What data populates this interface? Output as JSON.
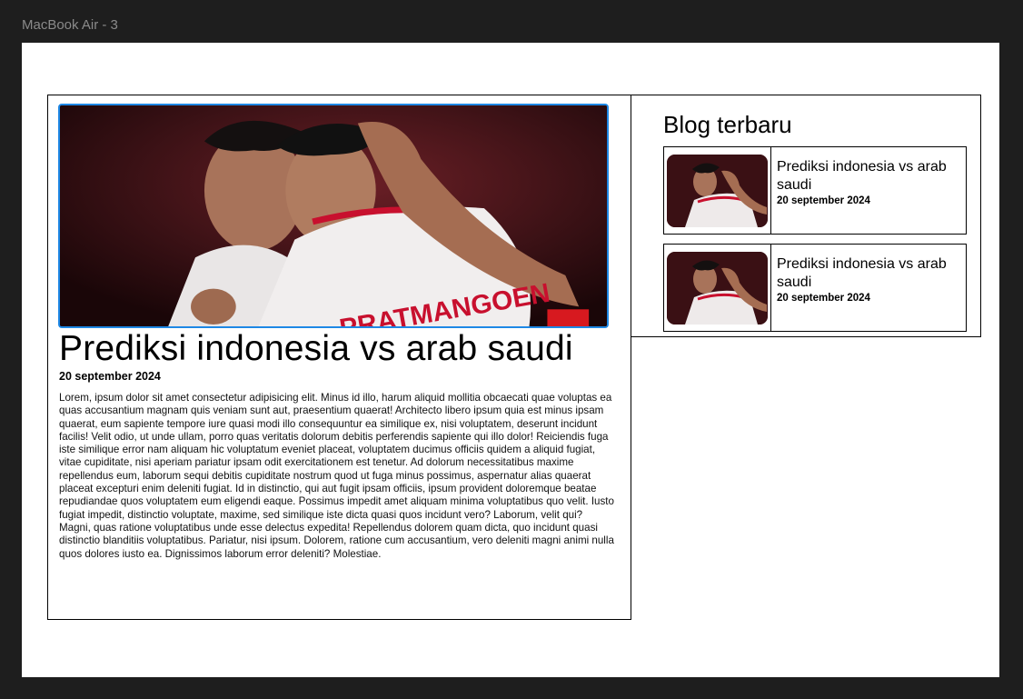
{
  "frame_label": "MacBook Air - 3",
  "article": {
    "title": "Prediksi indonesia vs arab saudi",
    "date": "20 september 2024",
    "body": "Lorem, ipsum dolor sit amet consectetur adipisicing elit. Minus id illo, harum aliquid mollitia obcaecati quae voluptas ea quas accusantium magnam quis veniam sunt aut, praesentium quaerat! Architecto libero ipsum quia est minus ipsam quaerat, eum sapiente tempore iure quasi modi illo consequuntur ea similique ex, nisi voluptatem, deserunt incidunt facilis! Velit odio, ut unde ullam, porro quas veritatis dolorum debitis perferendis sapiente qui illo dolor! Reiciendis fuga iste similique error nam aliquam hic voluptatum eveniet placeat, voluptatem ducimus officiis quidem a aliquid fugiat, vitae cupiditate, nisi aperiam pariatur ipsam odit exercitationem est tenetur. Ad dolorum necessitatibus maxime repellendus eum, laborum sequi debitis cupiditate nostrum quod ut fuga minus possimus, aspernatur alias quaerat placeat excepturi enim deleniti fugiat. Id in distinctio, qui aut fugit ipsam officiis, ipsum provident doloremque beatae repudiandae quos voluptatem eum eligendi eaque. Possimus impedit amet aliquam minima voluptatibus quo velit. Iusto fugiat impedit, distinctio voluptate, maxime, sed similique iste dicta quasi quos incidunt vero? Laborum, velit qui? Magni, quas ratione voluptatibus unde esse delectus expedita! Repellendus dolorem quam dicta, quo incidunt quasi distinctio blanditiis voluptatibus. Pariatur, nisi ipsum. Dolorem, ratione cum accusantium, vero deleniti magni animi nulla quos dolores iusto ea. Dignissimos laborum error deleniti? Molestiae.",
    "hero_jersey_text": "PRATMANGOEN"
  },
  "sidebar": {
    "title": "Blog terbaru",
    "cards": [
      {
        "title": "Prediksi indonesia vs arab saudi",
        "date": "20 september 2024"
      },
      {
        "title": "Prediksi indonesia vs arab saudi",
        "date": "20 september 2024"
      }
    ]
  },
  "colors": {
    "canvas_bg": "#1e1e1e",
    "frame_bg": "#ffffff",
    "selection": "#1e88e5",
    "jersey_red": "#c8102e"
  }
}
